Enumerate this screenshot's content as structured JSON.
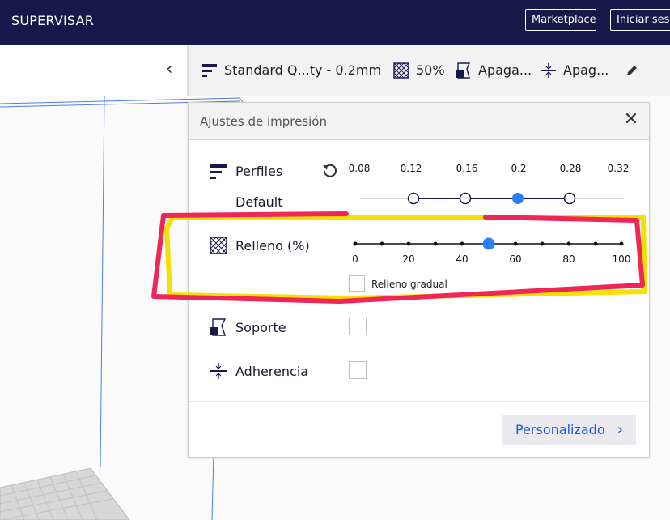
{
  "header": {
    "app_title": "SUPERVISAR",
    "marketplace_label": "Marketplace",
    "login_label": "Iniciar sesió"
  },
  "left_panel": {
    "collapse_icon": "chevron-left-icon"
  },
  "summary_bar": {
    "profile": "Standard Q...ty - 0.2mm",
    "infill": "50%",
    "support": "Apaga...",
    "adhesion": "Apag...",
    "edit_icon": "pencil-icon"
  },
  "panel": {
    "title": "Ajustes de impresión",
    "close_icon": "close-icon",
    "profiles": {
      "label": "Perfiles",
      "sub_label": "Default",
      "reset_icon": "reset-icon",
      "ticks": [
        "0.08",
        "0.12",
        "0.16",
        "0.2",
        "0.28",
        "0.32"
      ],
      "selected": "0.2"
    },
    "infill": {
      "label": "Relleno (%)",
      "ticks": [
        "0",
        "20",
        "40",
        "60",
        "80",
        "100"
      ],
      "value": 50,
      "gradual_label": "Relleno gradual",
      "gradual_checked": false
    },
    "support": {
      "label": "Soporte",
      "checked": false
    },
    "adhesion": {
      "label": "Adherencia",
      "checked": false
    },
    "custom_button": "Personalizado"
  },
  "colors": {
    "topbar": "#19184b",
    "accent": "#2d7ff9",
    "annotation_red": "#ee2758",
    "annotation_yellow": "#f5e000"
  }
}
